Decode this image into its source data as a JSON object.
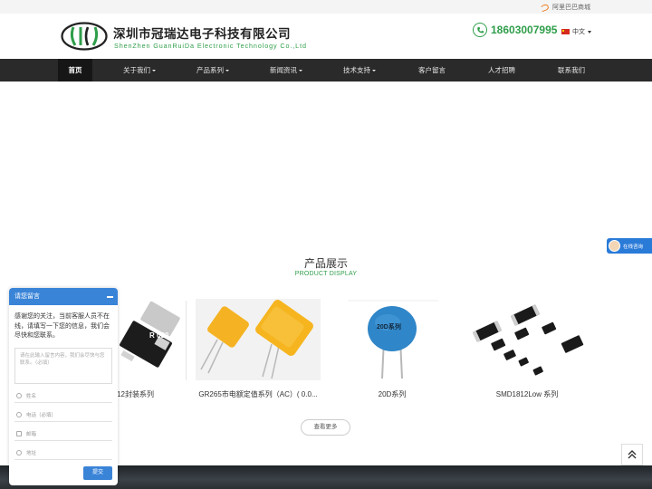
{
  "topbar": {
    "marketplace_link": "阿里巴巴商城"
  },
  "header": {
    "company_cn": "深圳市冠瑞达电子科技有限公司",
    "company_en": "ShenZhen  GuanRuiDa  Electronic  Technology Co.,Ltd",
    "phone": "18603007995",
    "language": "中文"
  },
  "nav": {
    "items": [
      {
        "label": "首页",
        "active": true,
        "dropdown": false
      },
      {
        "label": "关于我们",
        "dropdown": true
      },
      {
        "label": "产品系列",
        "dropdown": true
      },
      {
        "label": "新闻资讯",
        "dropdown": true
      },
      {
        "label": "技术支持",
        "dropdown": true
      },
      {
        "label": "客户留言",
        "dropdown": false
      },
      {
        "label": "人才招聘",
        "dropdown": false
      },
      {
        "label": "联系我们",
        "dropdown": false
      }
    ]
  },
  "products_section": {
    "title": "产品展示",
    "subtitle": "PRODUCT DISPLAY",
    "items": [
      {
        "name": "12封装系列",
        "image_label": "R 030"
      },
      {
        "name": "GR265市电额定值系列（AC）( 0.0..."
      },
      {
        "name": "20D系列",
        "image_label": "20D系列"
      },
      {
        "name": "SMD1812Low 系列"
      }
    ],
    "more_button": "查看更多"
  },
  "float": {
    "online_label": "在线咨询"
  },
  "message_panel": {
    "title": "请您留言",
    "intro": "感谢您的关注，当前客服人员不在线，请填写一下您的信息，我们会尽快和您联系。",
    "textarea_placeholder": "请在此输入留言内容，我们会尽快与您联系。（必填）",
    "fields": [
      {
        "placeholder": "姓名",
        "icon": "user-icon"
      },
      {
        "placeholder": "电话（必填）",
        "icon": "phone-icon"
      },
      {
        "placeholder": "邮箱",
        "icon": "mail-icon"
      },
      {
        "placeholder": "地址",
        "icon": "location-icon"
      }
    ],
    "submit": "提交"
  },
  "colors": {
    "brand_green": "#2f9e4a",
    "nav_bg": "#2a2a2a",
    "panel_blue": "#3a84d8"
  }
}
